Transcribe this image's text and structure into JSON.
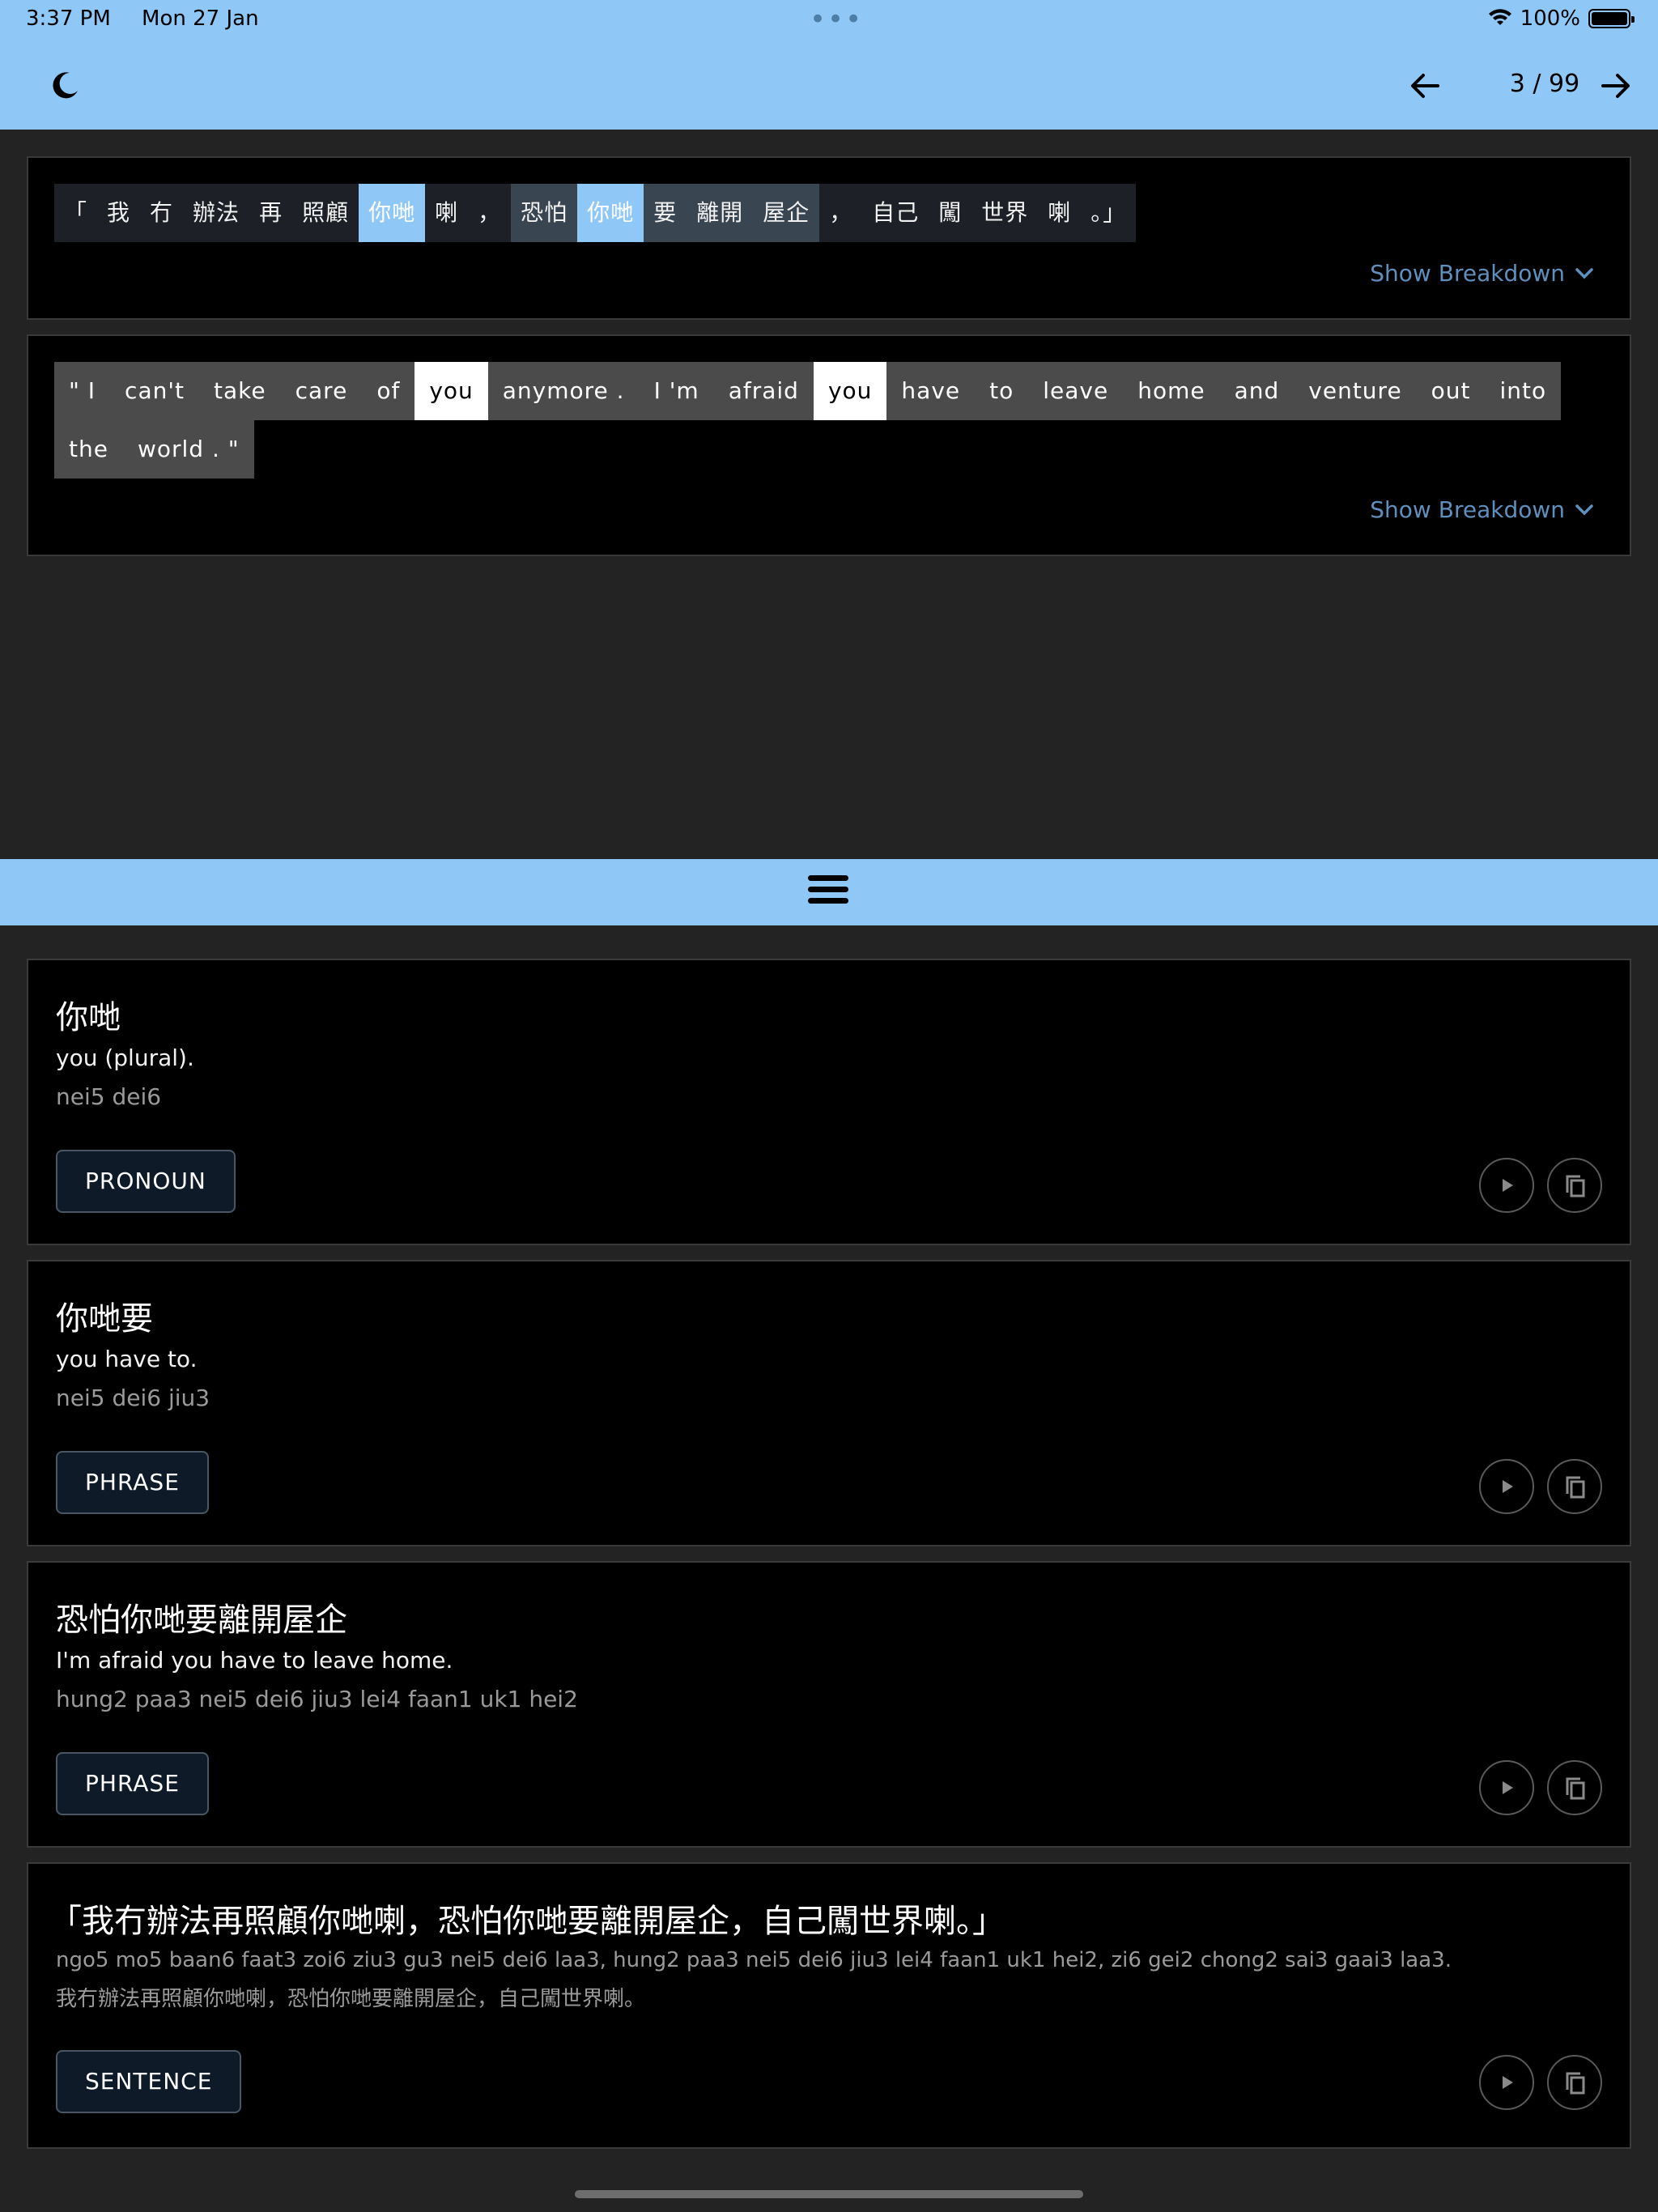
{
  "status_bar": {
    "time": "3:37 PM",
    "date": "Mon 27 Jan",
    "dots": "•••",
    "battery": "100%"
  },
  "nav": {
    "page": "3 / 99",
    "theme_icon": "moon-icon",
    "prev_icon": "arrow-left-icon",
    "next_icon": "arrow-right-icon"
  },
  "chinese_sentence": {
    "tokens": [
      {
        "text": "「",
        "style": "plain"
      },
      {
        "text": "我",
        "style": "plain"
      },
      {
        "text": "冇",
        "style": "plain"
      },
      {
        "text": "辦法",
        "style": "plain"
      },
      {
        "text": "再",
        "style": "plain"
      },
      {
        "text": "照顧",
        "style": "plain"
      },
      {
        "text": "你哋",
        "style": "highlight"
      },
      {
        "text": "喇",
        "style": "plain"
      },
      {
        "text": "，",
        "style": "plain"
      },
      {
        "text": "恐怕",
        "style": "mid"
      },
      {
        "text": "你哋",
        "style": "highlight"
      },
      {
        "text": "要",
        "style": "mid"
      },
      {
        "text": "離開",
        "style": "mid"
      },
      {
        "text": "屋企",
        "style": "mid"
      },
      {
        "text": "，",
        "style": "plain"
      },
      {
        "text": "自己",
        "style": "plain"
      },
      {
        "text": "闖",
        "style": "plain"
      },
      {
        "text": "世界",
        "style": "plain"
      },
      {
        "text": "喇",
        "style": "plain"
      },
      {
        "text": "。」",
        "style": "plain"
      }
    ],
    "breakdown_label": "Show Breakdown"
  },
  "english_sentence": {
    "tokens": [
      {
        "text": "\" I",
        "style": "plain"
      },
      {
        "text": "can't",
        "style": "plain"
      },
      {
        "text": "take",
        "style": "plain"
      },
      {
        "text": "care",
        "style": "plain"
      },
      {
        "text": "of",
        "style": "plain"
      },
      {
        "text": "you",
        "style": "highlight"
      },
      {
        "text": "anymore .",
        "style": "plain"
      },
      {
        "text": "I 'm",
        "style": "plain"
      },
      {
        "text": "afraid",
        "style": "plain"
      },
      {
        "text": "you",
        "style": "highlight"
      },
      {
        "text": "have",
        "style": "plain"
      },
      {
        "text": "to",
        "style": "plain"
      },
      {
        "text": "leave",
        "style": "plain"
      },
      {
        "text": "home",
        "style": "plain"
      },
      {
        "text": "and",
        "style": "plain"
      },
      {
        "text": "venture",
        "style": "plain"
      },
      {
        "text": "out",
        "style": "plain"
      },
      {
        "text": "into",
        "style": "plain"
      },
      {
        "text": "the",
        "style": "plain"
      },
      {
        "text": "world . \"",
        "style": "plain"
      }
    ],
    "breakdown_label": "Show Breakdown"
  },
  "entries": [
    {
      "headword": "你哋",
      "gloss": "you (plural).",
      "romanization": "nei5 dei6",
      "tag": "PRONOUN"
    },
    {
      "headword": "你哋要",
      "gloss": "you have to.",
      "romanization": "nei5 dei6 jiu3",
      "tag": "PHRASE"
    },
    {
      "headword": "恐怕你哋要離開屋企",
      "gloss": "I'm afraid you have to leave home.",
      "romanization": "hung2 paa3 nei5 dei6 jiu3 lei4 faan1 uk1 hei2",
      "tag": "PHRASE"
    },
    {
      "headword": "「我冇辦法再照顧你哋喇，恐怕你哋要離開屋企，自己闖世界喇。」",
      "gloss": "ngo5 mo5 baan6 faat3 zoi6 ziu3 gu3 nei5 dei6 laa3, hung2 paa3 nei5 dei6 jiu3 lei4 faan1 uk1 hei2, zi6 gei2 chong2 sai3 gaai3 laa3.",
      "romanization": "我冇辦法再照顧你哋喇，恐怕你哋要離開屋企，自己闖世界喇。",
      "tag": "SENTENCE"
    }
  ],
  "icons": {
    "play": "play-icon",
    "copy": "copy-icon",
    "drag": "drag-handle-icon",
    "chevron": "chevron-down-icon"
  },
  "colors": {
    "accent": "#8fc8f7",
    "background": "#232323",
    "card": "#000000",
    "link": "#5f8fbd"
  }
}
